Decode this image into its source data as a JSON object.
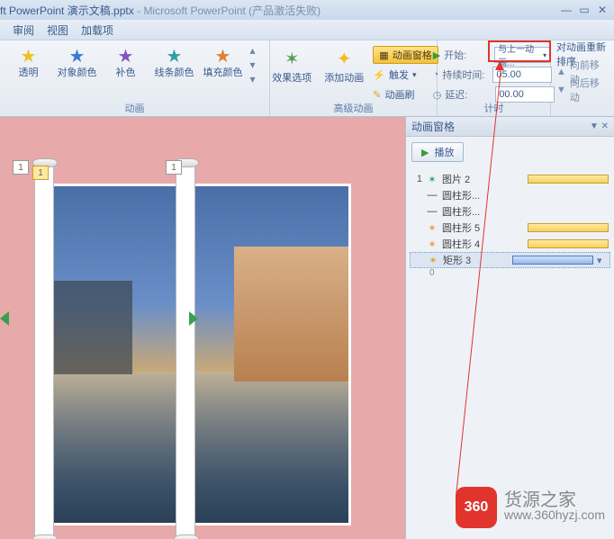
{
  "title": {
    "app_prefix": "ft PowerPoint",
    "file": "演示文稿.pptx",
    "sep": " - ",
    "app": "Microsoft PowerPoint",
    "status": "(产品激活失败)"
  },
  "menu": {
    "items": [
      "审阅",
      "视图",
      "加载项"
    ]
  },
  "ribbon": {
    "group_anim": {
      "label": "动画",
      "buttons": [
        {
          "label": "透明"
        },
        {
          "label": "对象颜色"
        },
        {
          "label": "补色"
        },
        {
          "label": "线条颜色"
        },
        {
          "label": "填充颜色"
        }
      ]
    },
    "group_adv": {
      "label": "高级动画",
      "effect_options": "效果选项",
      "add_anim": "添加动画",
      "anim_pane_btn": "动画窗格",
      "trigger": "触发",
      "anim_painter": "动画刷"
    },
    "group_timing": {
      "label": "计时",
      "start_lab": "开始:",
      "start_val": "与上一动画...",
      "dur_lab": "持续时间:",
      "dur_val": "05.00",
      "delay_lab": "延迟:",
      "delay_val": "00.00"
    },
    "group_reorder": {
      "label": "对动画重新排序",
      "fwd": "向前移动",
      "back": "向后移动"
    }
  },
  "slide": {
    "idx1": "1",
    "idx2": "1",
    "idx3": "1"
  },
  "anim_pane": {
    "title": "动画窗格",
    "play": "播放",
    "items": [
      {
        "idx": "1",
        "icon": "star",
        "name": "图片 2",
        "bar": true
      },
      {
        "idx": "",
        "icon": "dash",
        "name": "圆柱形...",
        "bar": false
      },
      {
        "idx": "",
        "icon": "dash",
        "name": "圆柱形...",
        "bar": false
      },
      {
        "idx": "",
        "icon": "star",
        "name": "圆柱形 5",
        "bar": true
      },
      {
        "idx": "",
        "icon": "star",
        "name": "圆柱形 4",
        "bar": true
      },
      {
        "idx": "",
        "icon": "star",
        "name": "矩形 3",
        "bar": true,
        "sel": true
      }
    ],
    "sub": "0"
  },
  "watermark": {
    "badge": "360",
    "line1": "货源之家",
    "line2": "www.360hyzj.com"
  }
}
